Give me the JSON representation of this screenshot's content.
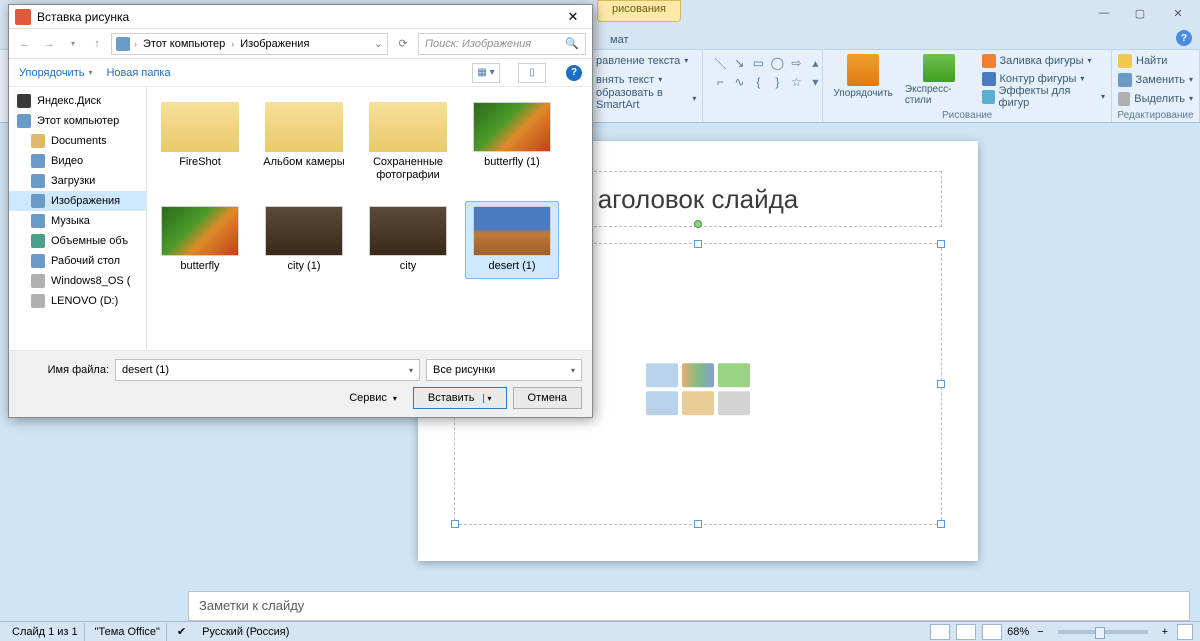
{
  "app": {
    "contextualTab": "рисования",
    "ribbonTab": "мат",
    "ribbon": {
      "textGroup": {
        "direction": "равление текста",
        "align": "внять текст",
        "smartart": "образовать в SmartArt"
      },
      "arrange": "Упорядочить",
      "quickStyles": "Экспресс-стили",
      "shapeFill": "Заливка фигуры",
      "shapeOutline": "Контур фигуры",
      "shapeEffects": "Эффекты для фигур",
      "groupDrawing": "Рисование",
      "find": "Найти",
      "replace": "Заменить",
      "select": "Выделить",
      "groupEdit": "Редактирование"
    }
  },
  "slide": {
    "titlePlaceholder": "аголовок слайда",
    "sub": "а"
  },
  "notes": {
    "placeholder": "Заметки к слайду"
  },
  "status": {
    "slideOf": "Слайд 1 из 1",
    "theme": "\"Тема Office\"",
    "lang": "Русский (Россия)",
    "zoom": "68%"
  },
  "dialog": {
    "title": "Вставка рисунка",
    "breadcrumb": [
      "Этот компьютер",
      "Изображения"
    ],
    "searchPlaceholder": "Поиск: Изображения",
    "toolbar": {
      "organize": "Упорядочить",
      "newFolder": "Новая папка"
    },
    "tree": [
      {
        "label": "Яндекс.Диск",
        "color": "#3a3a3a",
        "indent": "top"
      },
      {
        "label": "Этот компьютер",
        "color": "#6a9ac8",
        "indent": "top"
      },
      {
        "label": "Documents",
        "color": "#e0b86a"
      },
      {
        "label": "Видео",
        "color": "#6a9ac8"
      },
      {
        "label": "Загрузки",
        "color": "#6a9ac8"
      },
      {
        "label": "Изображения",
        "color": "#6a9ac8",
        "selected": true
      },
      {
        "label": "Музыка",
        "color": "#6a9ac8"
      },
      {
        "label": "Объемные объ",
        "color": "#4aa08a"
      },
      {
        "label": "Рабочий стол",
        "color": "#6a9ac8"
      },
      {
        "label": "Windows8_OS (",
        "color": "#b0b0b0"
      },
      {
        "label": "LENOVO (D:)",
        "color": "#b0b0b0"
      }
    ],
    "files": [
      {
        "label": "FireShot",
        "kind": "folder"
      },
      {
        "label": "Альбом камеры",
        "kind": "folder"
      },
      {
        "label": "Сохраненные фотографии",
        "kind": "folder"
      },
      {
        "label": "butterfly (1)",
        "kind": "img-butterfly"
      },
      {
        "label": "butterfly",
        "kind": "img-butterfly"
      },
      {
        "label": "city (1)",
        "kind": "img-city"
      },
      {
        "label": "city",
        "kind": "img-city"
      },
      {
        "label": "desert (1)",
        "kind": "img-desert",
        "selected": true
      }
    ],
    "filenameLabel": "Имя файла:",
    "filenameValue": "desert (1)",
    "filter": "Все рисунки",
    "tools": "Сервис",
    "ok": "Вставить",
    "cancel": "Отмена"
  }
}
